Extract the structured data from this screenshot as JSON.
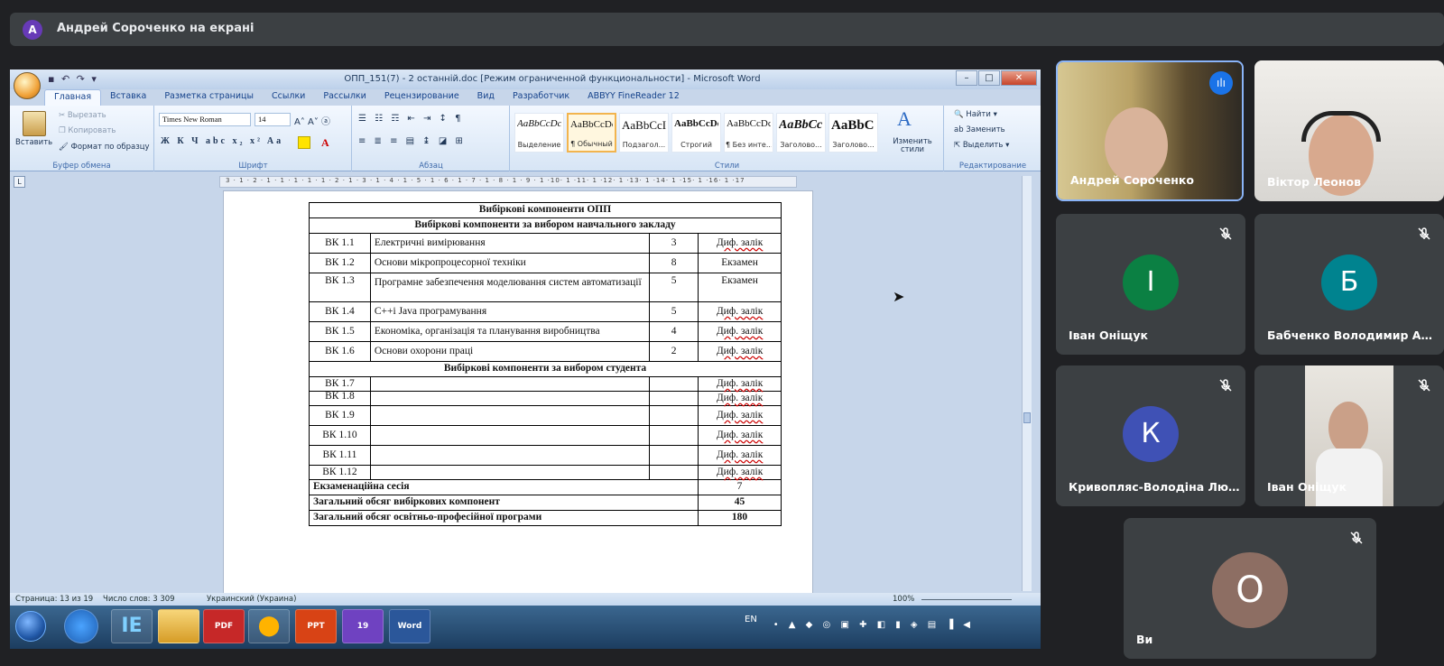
{
  "meet": {
    "presenter_initial": "А",
    "presenter_text": "Андрей Сороченко на екрані",
    "tiles": [
      {
        "name": "Андрей Сороченко",
        "kind": "video",
        "speaking": true
      },
      {
        "name": "Віктор Леонов",
        "kind": "video"
      },
      {
        "name": "Іван Оніщук",
        "kind": "avatar",
        "initial": "І",
        "color": "#0b8043",
        "muted": true
      },
      {
        "name": "Бабченко Володимир Ан...",
        "kind": "avatar",
        "initial": "Б",
        "color": "#00838f",
        "muted": true
      },
      {
        "name": "Кривопляс-Володіна Лю...",
        "kind": "avatar",
        "initial": "К",
        "color": "#3f51b5",
        "muted": true
      },
      {
        "name": "Іван Оніщук",
        "kind": "video",
        "muted": true
      },
      {
        "name": "Ви",
        "kind": "avatar",
        "initial": "О",
        "color": "#8d6e63",
        "muted": true
      }
    ]
  },
  "word": {
    "title": "ОПП_151(7) - 2 останній.doc [Режим ограниченной функциональности] - Microsoft Word",
    "tabs": [
      "Главная",
      "Вставка",
      "Разметка страницы",
      "Ссылки",
      "Рассылки",
      "Рецензирование",
      "Вид",
      "Разработчик",
      "ABBYY FineReader 12"
    ],
    "clipboard": {
      "paste": "Вставить",
      "cut": "Вырезать",
      "copy": "Копировать",
      "format": "Формат по образцу",
      "label": "Буфер обмена"
    },
    "font": {
      "name": "Times New Roman",
      "size": "14",
      "label": "Шрифт"
    },
    "paragraph_label": "Абзац",
    "styles": [
      {
        "sample": "AaBbCcDc",
        "name": "Выделение"
      },
      {
        "sample": "AaBbCcDc",
        "name": "¶ Обычный"
      },
      {
        "sample": "AaBbCcI",
        "name": "Подзагол..."
      },
      {
        "sample": "AaBbCcDd",
        "name": "Строгий"
      },
      {
        "sample": "AaBbCcDc",
        "name": "¶ Без инте..."
      },
      {
        "sample": "AaBbCc",
        "name": "Заголово..."
      },
      {
        "sample": "AaBbC",
        "name": "Заголово..."
      }
    ],
    "styles_label": "Стили",
    "change_styles": "Изменить стили",
    "editing": {
      "find": "Найти",
      "replace": "Заменить",
      "select": "Выделить",
      "label": "Редактирование"
    },
    "ruler": "3 · 1 · 2 · 1 · 1 · 1 · 1 · 1 · 2 · 1 · 3 · 1 · 4 · 1 · 5 · 1 · 6 · 1 · 7 · 1 · 8 · 1 · 9 · 1 ·10· 1 ·11· 1 ·12· 1 ·13· 1 ·14· 1 ·15· 1 ·16· 1 ·17",
    "table": {
      "title": "Вибіркові компоненти ОПП",
      "section1": "Вибіркові компоненти за вибором навчального закладу",
      "rows1": [
        [
          "ВК 1.1",
          "Електричні вимірювання",
          "3",
          "Диф. залік"
        ],
        [
          "ВК 1.2",
          "Основи мікропроцесорної техніки",
          "8",
          "Екзамен"
        ],
        [
          "ВК 1.3",
          "Програмне забезпечення моделювання систем автоматизації",
          "5",
          "Екзамен"
        ],
        [
          "ВК 1.4",
          "С++і Java програмування",
          "5",
          "Диф. залік"
        ],
        [
          "ВК 1.5",
          "Економіка, організація та планування виробництва",
          "4",
          "Диф. залік"
        ],
        [
          "ВК 1.6",
          "Основи охорони праці",
          "2",
          "Диф. залік"
        ]
      ],
      "section2": "Вибіркові компоненти за вибором студента",
      "rows2": [
        [
          "ВК 1.7",
          "",
          "",
          "Диф. залік"
        ],
        [
          "ВК 1.8",
          "",
          "",
          "Диф. залік"
        ],
        [
          "ВК 1.9",
          "",
          "",
          "Диф. залік"
        ],
        [
          "ВК 1.10",
          "",
          "",
          "Диф. залік"
        ],
        [
          "ВК 1.11",
          "",
          "",
          "Диф. залік"
        ],
        [
          "ВК 1.12",
          "",
          "",
          "Диф. залік"
        ]
      ],
      "totals": [
        [
          "Екзаменаційна сесія",
          "7"
        ],
        [
          "Загальний обсяг вибіркових компонент",
          "45"
        ],
        [
          "Загальний обсяг освітньо-професійної програми",
          "180"
        ]
      ]
    },
    "status": {
      "page": "Страница: 13 из 19",
      "words": "Число слов: 3 309",
      "lang": "Украинский (Украина)",
      "zoom": "100%"
    },
    "taskbar": {
      "lang": "EN",
      "apps": [
        "IE",
        "Explorer",
        "PDF",
        "Opera",
        "PPT",
        "Viber",
        "Word"
      ],
      "viber_badge": "19"
    }
  }
}
